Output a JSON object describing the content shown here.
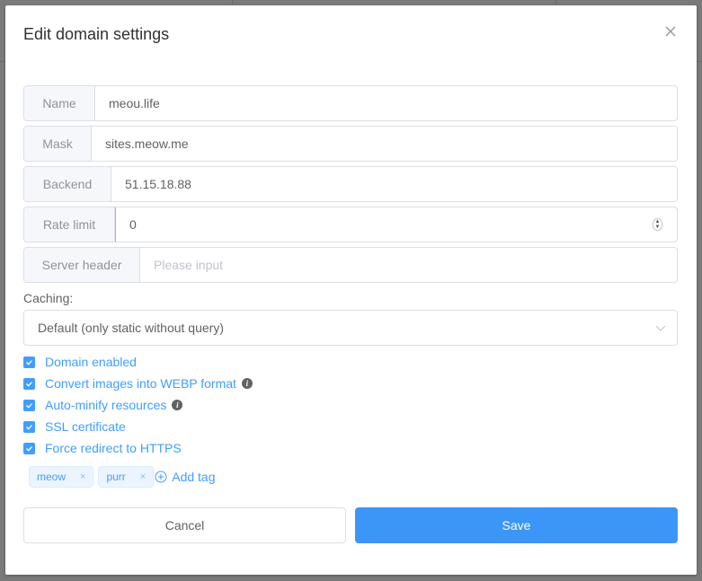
{
  "dialog": {
    "title": "Edit domain settings",
    "close_icon": "close-icon"
  },
  "fields": {
    "name": {
      "label": "Name",
      "value": "meou.life"
    },
    "mask": {
      "label": "Mask",
      "value": "sites.meow.me"
    },
    "backend": {
      "label": "Backend",
      "value": "51.15.18.88"
    },
    "rate_limit": {
      "label": "Rate limit",
      "value": "0"
    },
    "server_header": {
      "label": "Server header",
      "value": "",
      "placeholder": "Please input"
    }
  },
  "caching": {
    "label": "Caching:",
    "selected": "Default (only static without query)"
  },
  "options": [
    {
      "label": "Domain enabled",
      "checked": true,
      "info": false
    },
    {
      "label": "Convert images into WEBP format",
      "checked": true,
      "info": true
    },
    {
      "label": "Auto-minify resources",
      "checked": true,
      "info": true
    },
    {
      "label": "SSL certificate",
      "checked": true,
      "info": false
    },
    {
      "label": "Force redirect to HTTPS",
      "checked": true,
      "info": false
    }
  ],
  "tags": {
    "items": [
      "meow",
      "purr"
    ],
    "remove_glyph": "×",
    "add_label": "Add tag"
  },
  "buttons": {
    "cancel": "Cancel",
    "save": "Save"
  },
  "colors": {
    "primary": "#409eff",
    "save_button": "#3c96f8"
  },
  "info_glyph": "i"
}
